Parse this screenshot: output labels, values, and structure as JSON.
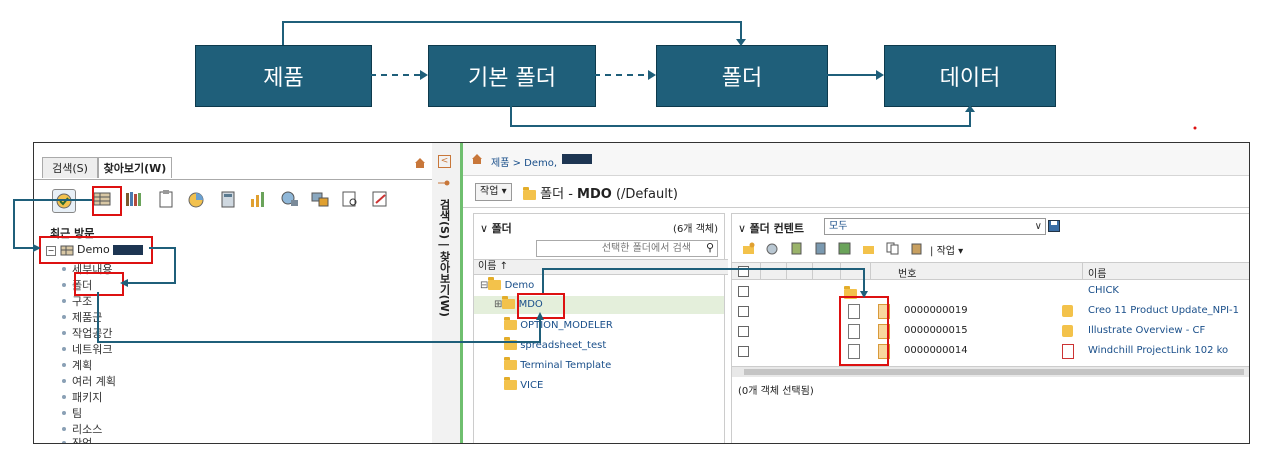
{
  "flow": {
    "boxes": [
      "제품",
      "기본 폴더",
      "폴더",
      "데이터"
    ]
  },
  "left_panel": {
    "tabs": [
      "검색(S)",
      "찾아보기(W)"
    ],
    "recent_label": "최근 방문",
    "root_label": "Demo",
    "items": [
      "세부내용",
      "폴더",
      "구조",
      "제품군",
      "작업공간",
      "네트워크",
      "계획",
      "여러 계획",
      "패키지",
      "팀",
      "리소스",
      "작업"
    ]
  },
  "vertical_strip": {
    "label": "검색(S) | 찾아보기(W)"
  },
  "right_panel": {
    "breadcrumb": "제품 > Demo,",
    "action_button": "작업",
    "folder_title_prefix": "폴더 - ",
    "folder_name": "MDO",
    "folder_path": "(/Default)",
    "folders_section": {
      "title": "폴더",
      "count": "(6개 객체)",
      "search_placeholder": "선택한 폴더에서 검색",
      "column_header": "이름 ↑",
      "tree": [
        "Demo",
        "MDO",
        "OPTION_MODELER",
        "spreadsheet_test",
        "Terminal Template",
        "VICE"
      ]
    },
    "contents_section": {
      "title": "폴더 컨텐트",
      "filter_value": "모두",
      "toolbar_action": "작업",
      "columns": [
        "번호",
        "이름"
      ],
      "rows": [
        {
          "number": "",
          "name": "CHICK"
        },
        {
          "number": "0000000019",
          "name": "Creo 11 Product Update_NPI-1"
        },
        {
          "number": "0000000015",
          "name": "Illustrate Overview - CF"
        },
        {
          "number": "0000000014",
          "name": "Windchill ProjectLink 102 ko"
        }
      ],
      "status": "(0개 객체 선택됨)"
    }
  },
  "colors": {
    "flow_box": "#1f5f7a",
    "highlight": "#dd1111",
    "link": "#1a4f8a"
  }
}
